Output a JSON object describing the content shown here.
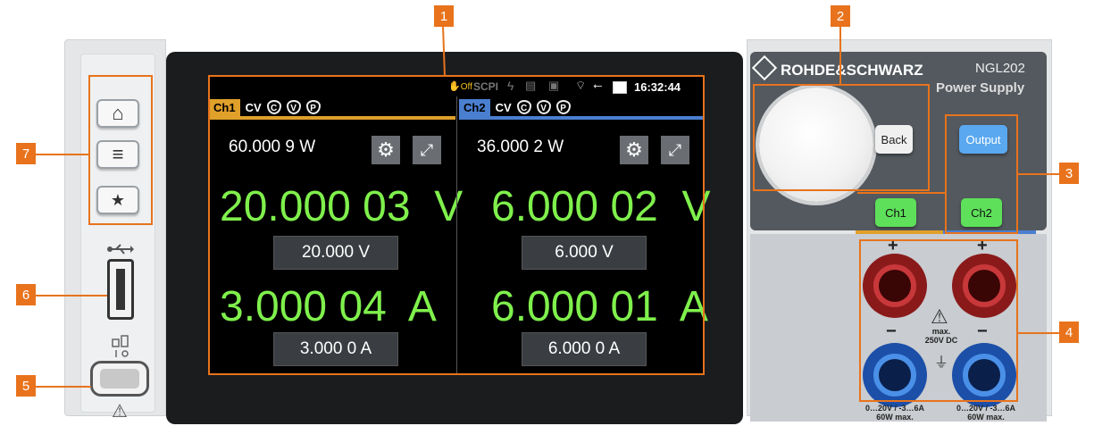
{
  "callouts": [
    "1",
    "2",
    "3",
    "4",
    "5",
    "6",
    "7"
  ],
  "left_panel": {
    "buttons": [
      {
        "icon": "home-icon",
        "glyph": "⌂"
      },
      {
        "icon": "menu-icon",
        "glyph": "≡"
      },
      {
        "icon": "star-icon",
        "glyph": "★"
      }
    ],
    "usb_glyph": "⭠",
    "network_glyph": "⊟",
    "warning_glyph": "⚠"
  },
  "status_bar": {
    "remote_off": "Off",
    "scpi": "SCPI",
    "time": "16:32:44"
  },
  "channels": [
    {
      "tag": "Ch1",
      "mode": "CV",
      "protections": [
        "C",
        "V",
        "P"
      ],
      "power": "60.000 9 W",
      "voltage": "20.000 03  V",
      "current": "3.000 04  A",
      "voltage_set": "20.000 V",
      "current_set": "3.000 0 A",
      "color": "#e0a02a"
    },
    {
      "tag": "Ch2",
      "mode": "CV",
      "protections": [
        "C",
        "V",
        "P"
      ],
      "power": "36.000 2 W",
      "voltage": "6.000 02  V",
      "current": "6.000 01  A",
      "voltage_set": "6.000 V",
      "current_set": "6.000 0 A",
      "color": "#4a7fd0"
    }
  ],
  "right_panel": {
    "brand": "ROHDE&SCHWARZ",
    "model": "NGL202",
    "product": "Power Supply",
    "back_label": "Back",
    "output_label": "Output",
    "ch1_label": "Ch1",
    "ch2_label": "Ch2",
    "plus": "+",
    "minus": "−",
    "max_label": "max.\n250V DC",
    "rating_left": "0…20V / -3…6A\n60W max.",
    "rating_right": "0…20V / -3…6A\n60W max."
  },
  "colors": {
    "accent": "#e8731c",
    "reading": "#7ff04c",
    "ch1": "#e0a02a",
    "ch2": "#4a7fd0"
  }
}
